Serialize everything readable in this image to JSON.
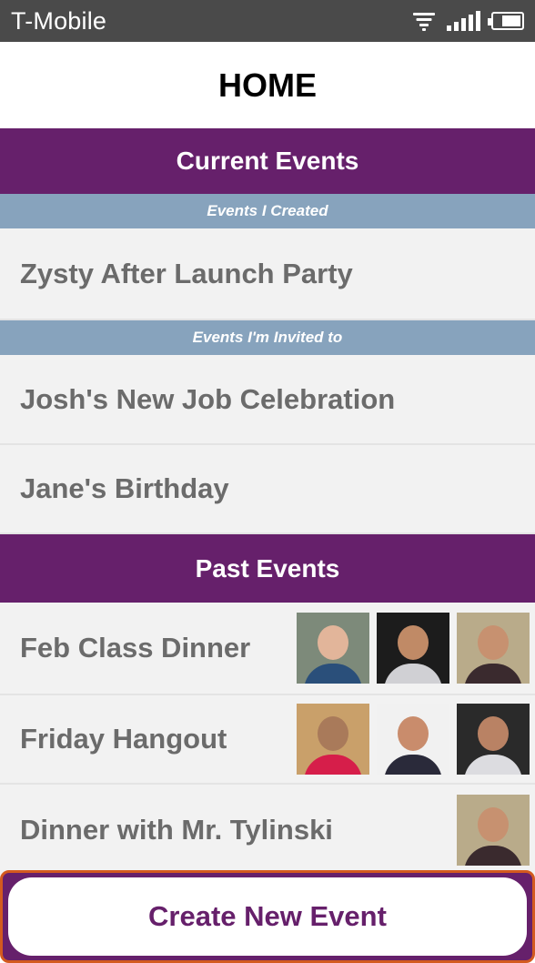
{
  "status_bar": {
    "carrier": "T-Mobile",
    "icons": [
      "wifi-icon",
      "signal-icon",
      "battery-icon"
    ]
  },
  "header": {
    "title": "HOME"
  },
  "current": {
    "title": "Current Events",
    "created_label": "Events I Created",
    "created_events": [
      "Zysty After Launch Party"
    ],
    "invited_label": "Events I'm Invited to",
    "invited_events": [
      "Josh's New Job Celebration",
      "Jane's Birthday"
    ]
  },
  "past": {
    "title": "Past Events",
    "events": [
      {
        "name": "Feb Class Dinner",
        "avatars": 3
      },
      {
        "name": "Friday Hangout",
        "avatars": 3
      },
      {
        "name": "Dinner with Mr. Tylinski",
        "avatars": 1
      }
    ]
  },
  "actions": {
    "create_label": "Create New Event"
  },
  "colors": {
    "primary": "#66206b",
    "subheader": "#87a3bd",
    "row": "#f2f2f2",
    "accent_border": "#d35a1f"
  }
}
